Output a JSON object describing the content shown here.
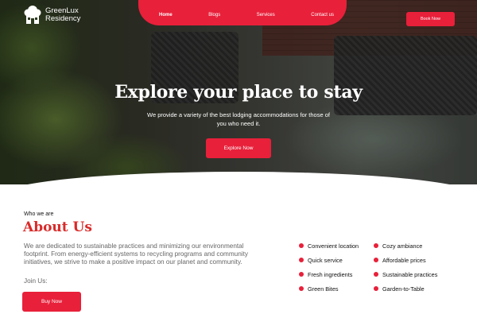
{
  "brand": {
    "name_line1": "GreenLux",
    "name_line2": "Residency"
  },
  "nav": {
    "links": [
      {
        "label": "Home",
        "active": true
      },
      {
        "label": "Blogs",
        "active": false
      },
      {
        "label": "Services",
        "active": false
      },
      {
        "label": "Contact us",
        "active": false
      }
    ],
    "book_label": "Book Now"
  },
  "hero": {
    "title": "Explore your place to stay",
    "description": "We provide a variety of the best lodging accommodations for those of you who need it.",
    "cta_label": "Explore Now"
  },
  "about": {
    "eyebrow": "Who we are",
    "title": "About Us",
    "text": "We are dedicated to sustainable practices and minimizing our environmental footprint. From energy-efficient systems to recycling programs and community initiatives, we strive to make a positive impact on our planet and community.",
    "join": "Join Us:",
    "cta_label": "Buy Now",
    "features": [
      "Convenient location",
      "Cozy ambiance",
      "Quick service",
      "Affordable prices",
      "Fresh ingredients",
      "Sustainable practices",
      "Green Bites",
      "Garden-to-Table"
    ]
  },
  "colors": {
    "accent": "#e8203a",
    "heading_red": "#d92a2a",
    "body_text": "#666666"
  }
}
